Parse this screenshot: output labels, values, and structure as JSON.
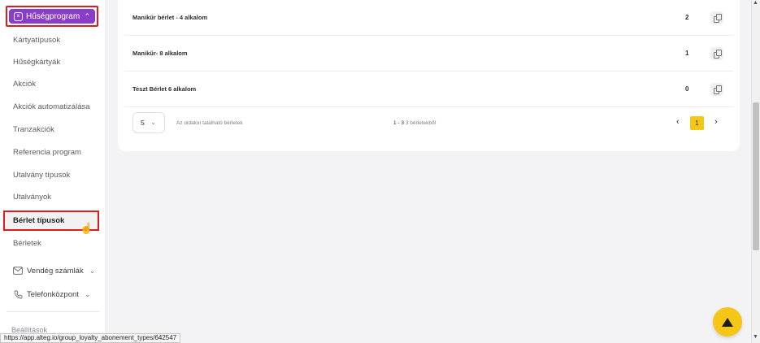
{
  "sidebar": {
    "loyalty_label": "Hűségprogram",
    "items": [
      {
        "label": "Kártyatípusok"
      },
      {
        "label": "Hűségkártyák"
      },
      {
        "label": "Akciók"
      },
      {
        "label": "Akciók automatizálása"
      },
      {
        "label": "Tranzakciók"
      },
      {
        "label": "Referencia program"
      },
      {
        "label": "Utalvány típusok"
      },
      {
        "label": "Utalványok"
      }
    ],
    "active_label": "Bérlet típusok",
    "after_active": {
      "label": "Bérletek"
    },
    "groups": [
      {
        "label": "Vendég számlák",
        "icon": "envelope-icon"
      },
      {
        "label": "Telefonközpont",
        "icon": "phone-icon"
      }
    ],
    "hidden_label": "Beállítások"
  },
  "table": {
    "rows": [
      {
        "name": "Manikűr bérlet - 4 alkalom",
        "count": "2"
      },
      {
        "name": "Manikűr- 8 alkalom",
        "count": "1"
      },
      {
        "name": "Teszt Bérlet 6 alkalom",
        "count": "0"
      }
    ]
  },
  "pagination": {
    "per_page": "5",
    "per_page_label": "Az oldalon található bérletek",
    "range": "1 - 3",
    "range_suffix": "3 bérletekből",
    "current_page": "1"
  },
  "status_url": "https://app.alteg.io/group_loyalty_abonement_types/642547",
  "colors": {
    "accent": "#8a3ec7",
    "highlight": "#f5c518",
    "annotation": "#e21a1a"
  }
}
